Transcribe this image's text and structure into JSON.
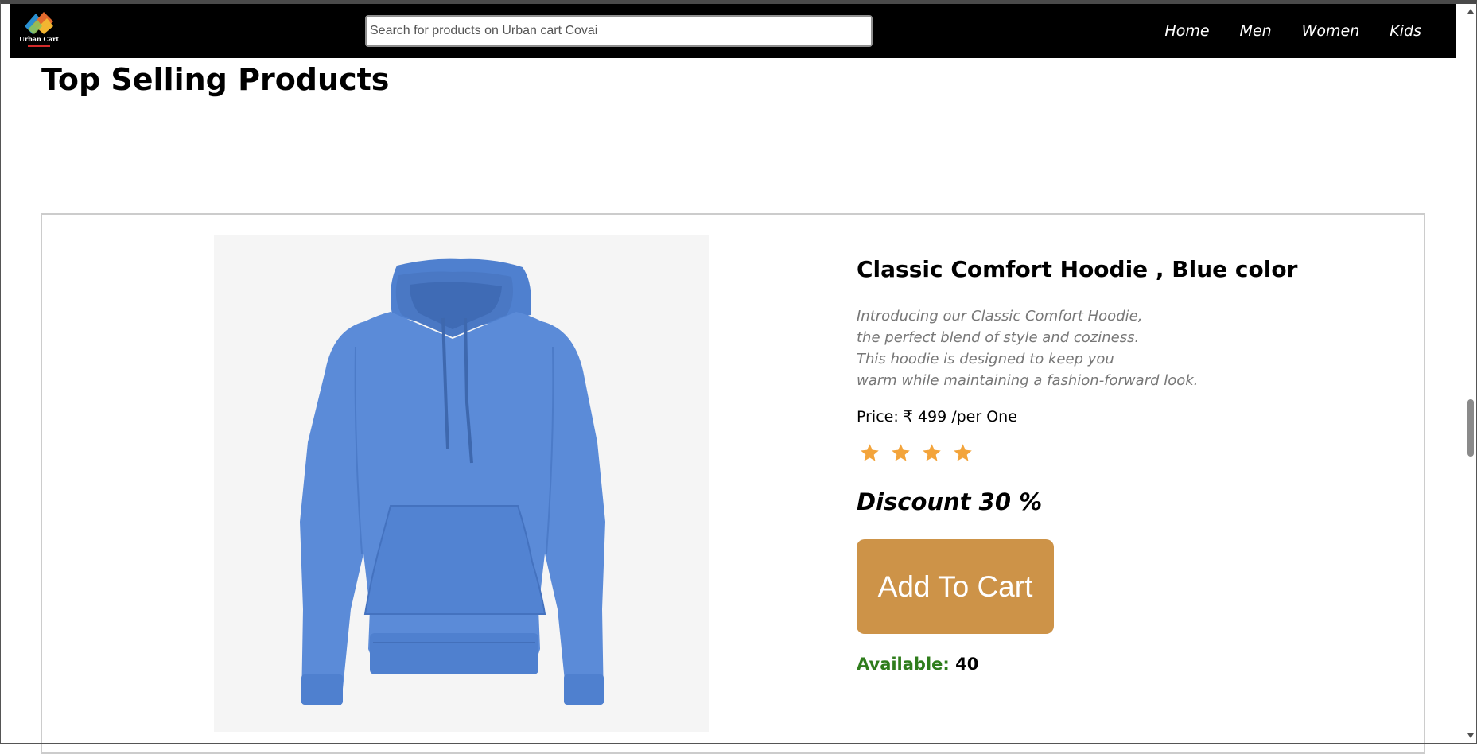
{
  "header": {
    "logo_text": "Urban Cart",
    "search": {
      "placeholder": "Search for products on Urban cart Covai",
      "value": ""
    },
    "nav": [
      {
        "label": "Home"
      },
      {
        "label": "Men"
      },
      {
        "label": "Women"
      },
      {
        "label": "Kids"
      }
    ]
  },
  "section": {
    "title": "Top Selling Products"
  },
  "product": {
    "name": "Classic Comfort Hoodie , Blue color",
    "image_icon": "blue-hoodie-image",
    "description": [
      "Introducing our Classic Comfort Hoodie,",
      "the perfect blend of style and coziness.",
      "This hoodie is designed to keep you",
      "warm while maintaining a fashion-forward look."
    ],
    "price": "Price: ₹ 499 /per One",
    "rating": {
      "stars": 4,
      "color": "#f3a43b"
    },
    "discount": "Discount 30 %",
    "add_to_cart_label": "Add To Cart",
    "availability_label": "Available:",
    "availability_value": "40",
    "button_color": "#cd9348",
    "hoodie_color": "#5b8bd8"
  }
}
